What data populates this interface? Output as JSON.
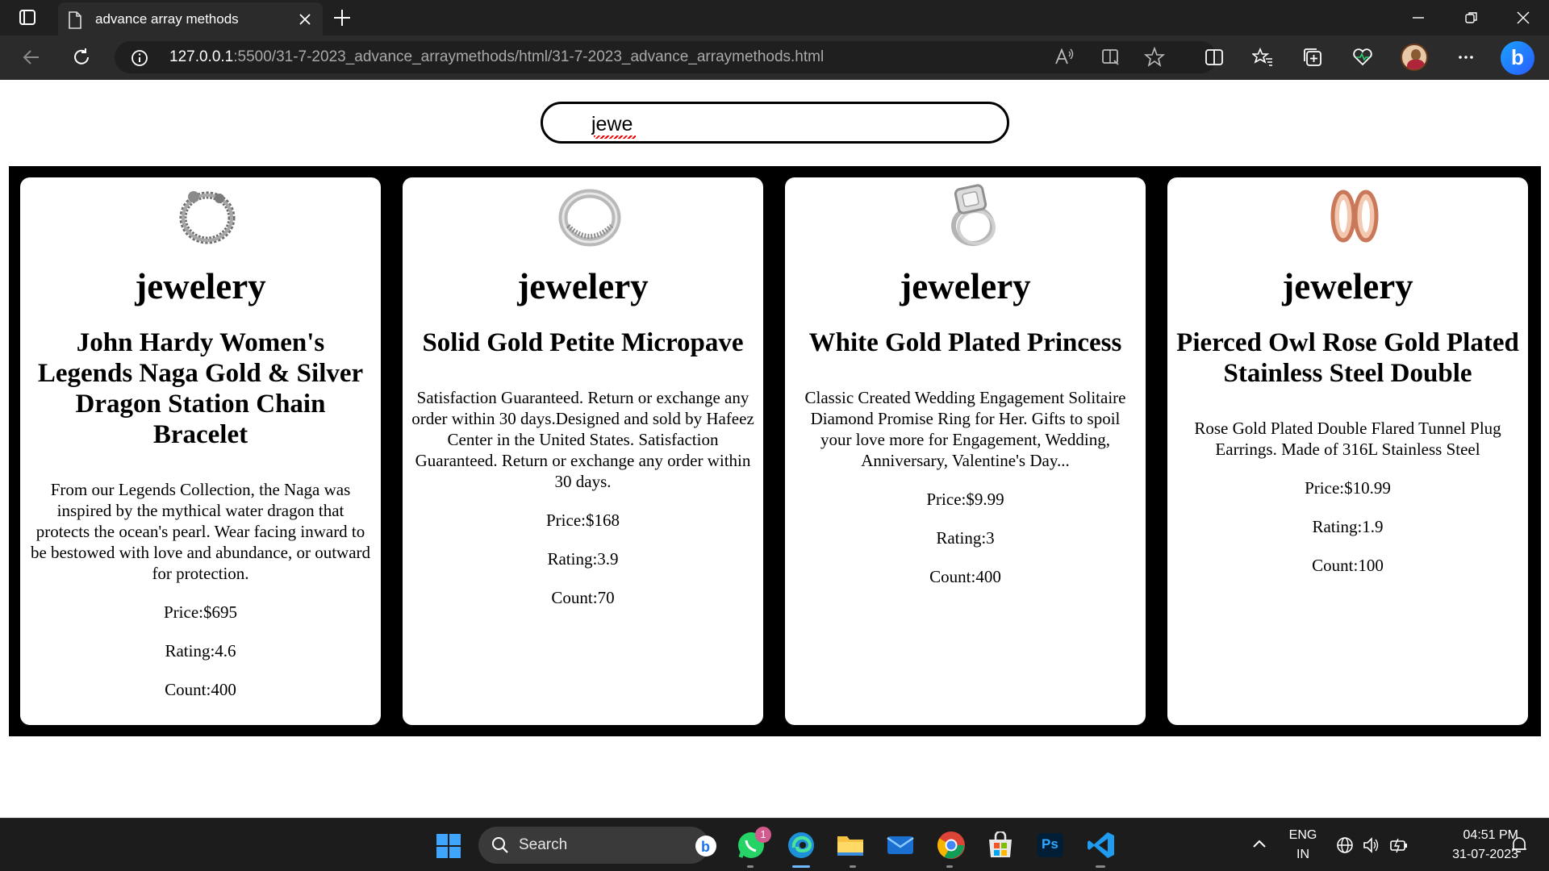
{
  "browser": {
    "tab_title": "advance array methods",
    "url_host": "127.0.0.1",
    "url_rest": ":5500/31-7-2023_advance_arraymethods/html/31-7-2023_advance_arraymethods.html"
  },
  "search": {
    "value": "jewe"
  },
  "products": [
    {
      "category": "jewelery",
      "title": "John Hardy Women's Legends Naga Gold & Silver Dragon Station Chain Bracelet",
      "description": "From our Legends Collection, the Naga was inspired by the mythical water dragon that protects the ocean's pearl. Wear facing inward to be bestowed with love and abundance, or outward for protection.",
      "price": "Price:$695",
      "rating": "Rating:4.6",
      "count": "Count:400",
      "image_icon": "bracelet-icon"
    },
    {
      "category": "jewelery",
      "title": "Solid Gold Petite Micropave",
      "description": "Satisfaction Guaranteed. Return or exchange any order within 30 days.Designed and sold by Hafeez Center in the United States. Satisfaction Guaranteed. Return or exchange any order within 30 days.",
      "price": "Price:$168",
      "rating": "Rating:3.9",
      "count": "Count:70",
      "image_icon": "ring-icon"
    },
    {
      "category": "jewelery",
      "title": "White Gold Plated Princess",
      "description": "Classic Created Wedding Engagement Solitaire Diamond Promise Ring for Her. Gifts to spoil your love more for Engagement, Wedding, Anniversary, Valentine's Day...",
      "price": "Price:$9.99",
      "rating": "Rating:3",
      "count": "Count:400",
      "image_icon": "diamond-ring-icon"
    },
    {
      "category": "jewelery",
      "title": "Pierced Owl Rose Gold Plated Stainless Steel Double",
      "description": "Rose Gold Plated Double Flared Tunnel Plug Earrings. Made of 316L Stainless Steel",
      "price": "Price:$10.99",
      "rating": "Rating:1.9",
      "count": "Count:100",
      "image_icon": "earrings-icon"
    }
  ],
  "taskbar": {
    "search_label": "Search",
    "whatsapp_badge": "1",
    "lang_top": "ENG",
    "lang_bottom": "IN",
    "time": "04:51 PM",
    "date": "31-07-2023",
    "ps_label": "Ps"
  },
  "colors": {
    "page_background": "#ffffff",
    "products_background": "#000000",
    "card_background": "#ffffff",
    "chrome_dark": "#202020",
    "taskbar": "#1c1c1c"
  }
}
